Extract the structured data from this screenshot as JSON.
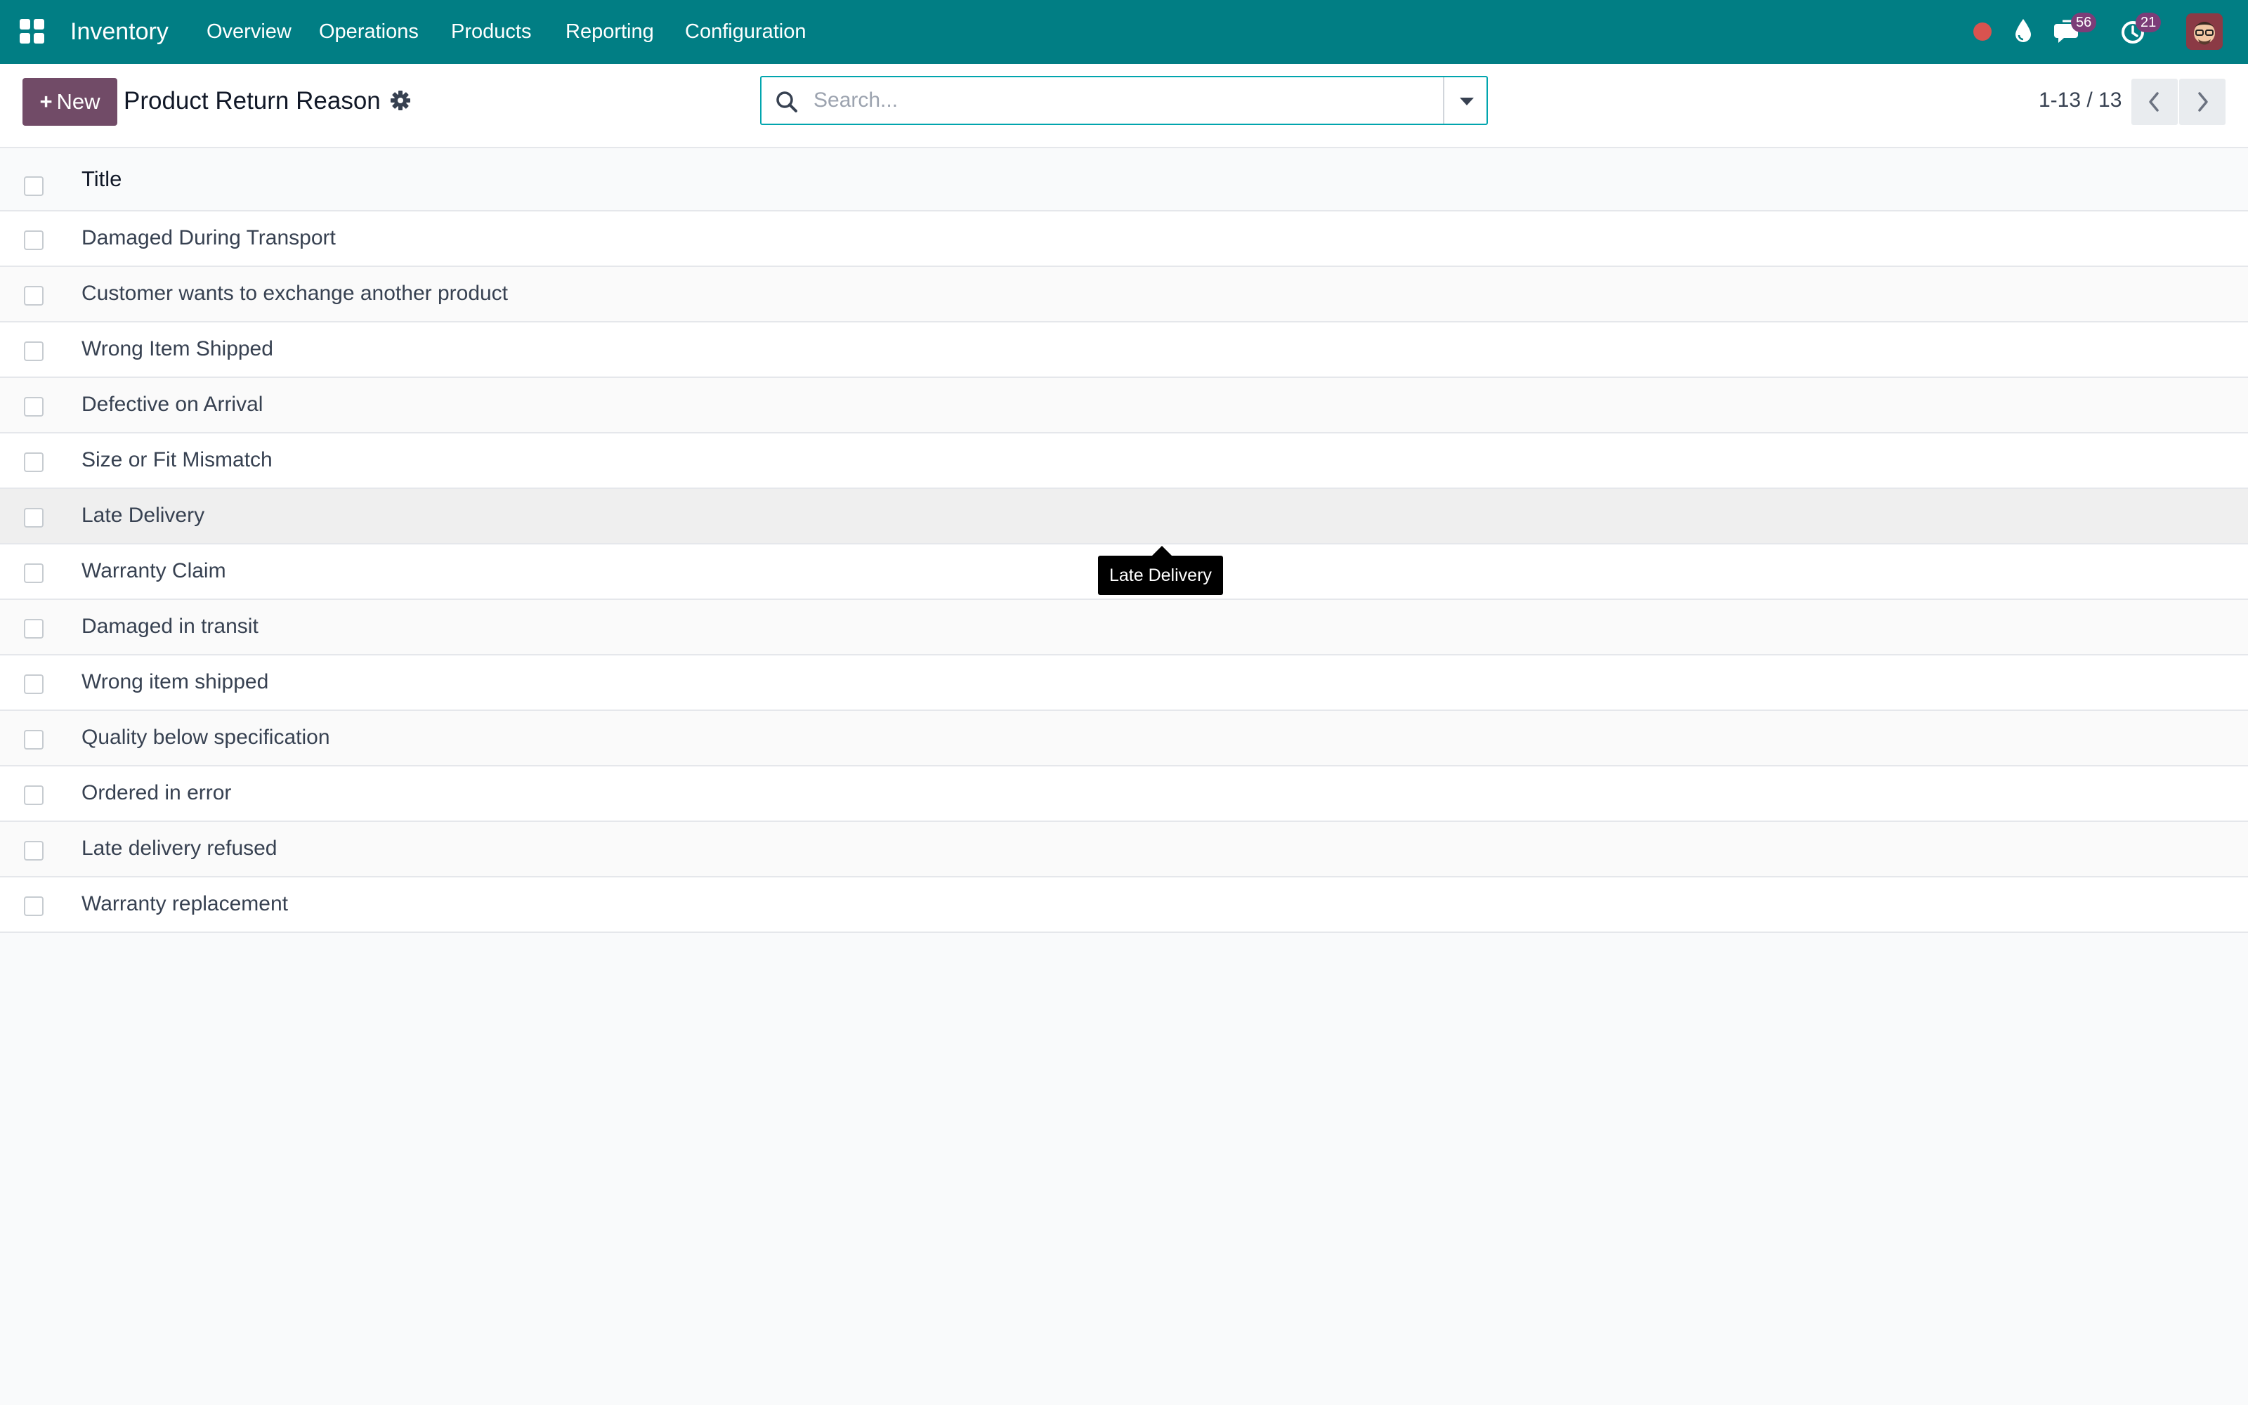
{
  "navbar": {
    "app_name": "Inventory",
    "menus": [
      "Overview",
      "Operations",
      "Products",
      "Reporting",
      "Configuration"
    ],
    "systray": {
      "recording_icon": "record-dot-icon",
      "drop_icon": "drop-icon",
      "messages_count": "56",
      "activities_count": "21"
    },
    "colors": {
      "bar": "#017e84",
      "badge": "#7c3d78"
    }
  },
  "control_panel": {
    "new_label": "New",
    "title": "Product Return Reason",
    "search_placeholder": "Search...",
    "pager_value": "1-13 / 13",
    "new_button_color": "#714b67"
  },
  "list": {
    "column_title": "Title",
    "rows": [
      "Damaged During Transport",
      "Customer wants to exchange another product",
      "Wrong Item Shipped",
      "Defective on Arrival",
      "Size or Fit Mismatch",
      "Late Delivery",
      "Warranty Claim",
      "Damaged in transit",
      "Wrong item shipped",
      "Quality below specification",
      "Ordered in error",
      "Late delivery refused",
      "Warranty replacement"
    ],
    "hovered_row": 5
  },
  "tooltip": {
    "text": "Late Delivery"
  }
}
